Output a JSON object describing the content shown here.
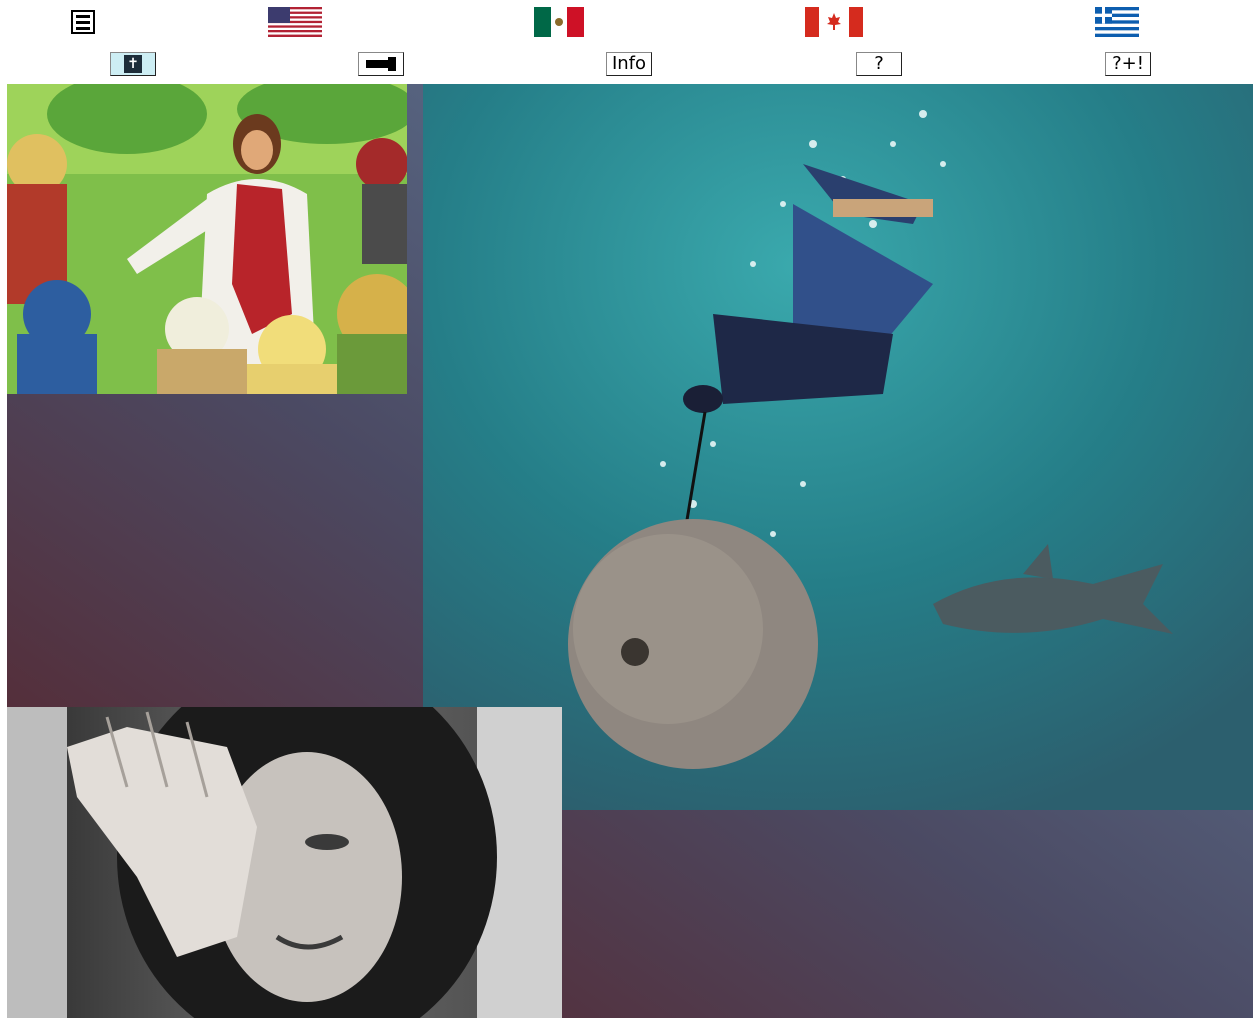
{
  "toolbar": {
    "menu_icon": "hamburger-menu-icon",
    "flags": [
      {
        "name": "us-flag-icon",
        "colors": [
          "#b22234",
          "#ffffff",
          "#3c3b6e"
        ]
      },
      {
        "name": "mexico-flag-icon",
        "colors": [
          "#006847",
          "#ffffff",
          "#ce1126"
        ]
      },
      {
        "name": "canada-flag-icon",
        "colors": [
          "#d52b1e",
          "#ffffff"
        ]
      },
      {
        "name": "greece-flag-icon",
        "colors": [
          "#0d5eaf",
          "#ffffff"
        ]
      }
    ]
  },
  "buttons": {
    "bible_icon": "bible-book-icon",
    "bible_glyph": "✝",
    "reading_icon": "pointer-bar-icon",
    "info_label": "Info",
    "help_label": "?",
    "more_help_label": "?+!"
  },
  "images": {
    "jesus": "jesus-with-disciples-illustration",
    "drowning": "man-drowning-with-millstone-illustration",
    "woman": "crying-woman-photo"
  },
  "colors": {
    "background_dark": "#5a1e22",
    "background_mid": "#4b4a63",
    "background_light": "#6585a6",
    "water": "#2a8f98"
  }
}
